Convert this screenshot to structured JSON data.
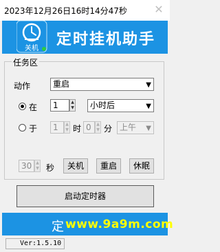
{
  "window": {
    "title": "2023年12月26日16时14分47秒",
    "close_glyph": "✕"
  },
  "banner": {
    "icon_label": "关机",
    "title": "定时挂机助手",
    "background": "#1c93e3"
  },
  "task_group": {
    "legend": "任务区",
    "action_label": "动作",
    "action_value": "重启",
    "mode_after": {
      "label": "在",
      "selected": true,
      "amount": "1",
      "unit": "小时后"
    },
    "mode_at": {
      "label": "于",
      "selected": false,
      "hour": "1",
      "hour_unit": "时",
      "minute": "0",
      "minute_unit": "分",
      "period": "上午"
    },
    "quick": {
      "seconds": "30",
      "seconds_unit": "秒",
      "shutdown_label": "关机",
      "restart_label": "重启",
      "sleep_label": "休眠"
    }
  },
  "start_button_label": "启动定时器",
  "footer": {
    "text": "定",
    "watermark": "www.9a9m.com"
  },
  "version": "Ver:1.5.10"
}
